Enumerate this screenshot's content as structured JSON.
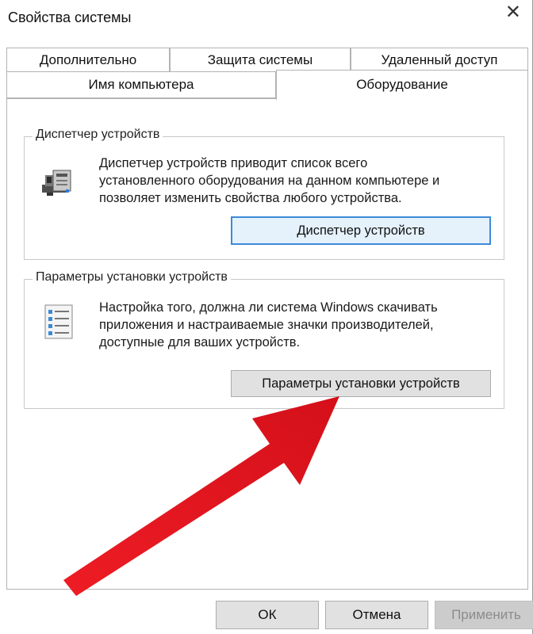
{
  "window": {
    "title": "Свойства системы",
    "close_glyph": "✕"
  },
  "tabs": [
    {
      "label": "Дополнительно",
      "active": false
    },
    {
      "label": "Защита системы",
      "active": false
    },
    {
      "label": "Удаленный доступ",
      "active": false
    },
    {
      "label": "Имя компьютера",
      "active": false
    },
    {
      "label": "Оборудование",
      "active": true
    }
  ],
  "device_manager": {
    "legend": "Диспетчер устройств",
    "description_lines": [
      "Диспетчер устройств приводит список всего",
      "установленного оборудования на данном компьютере и",
      "позволяет изменить свойства любого устройства."
    ],
    "button_label": "Диспетчер устройств",
    "icon": "device-manager-icon"
  },
  "install_settings": {
    "legend": "Параметры установки устройств",
    "description_lines": [
      "Настройка того, должна ли система Windows скачивать",
      "приложения и настраиваемые значки производителей,",
      "доступные для ваших устройств."
    ],
    "button_label": "Параметры установки устройств",
    "icon": "checklist-icon"
  },
  "footer": {
    "ok_label": "ОК",
    "cancel_label": "Отмена",
    "apply_label": "Применить",
    "apply_enabled": false
  },
  "colors": {
    "accent": "#3c8ad8",
    "arrow": "#e8141b",
    "button_face": "#e1e1e1"
  }
}
